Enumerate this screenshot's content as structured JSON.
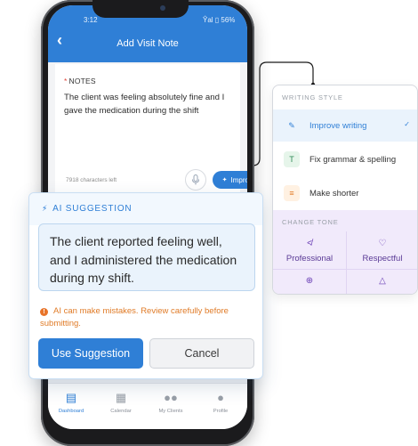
{
  "status": {
    "time": "3:12",
    "right": "Ŷal ▯ 56%"
  },
  "app": {
    "back_icon": "chevron-left-icon",
    "title": "Add Visit Note"
  },
  "notes": {
    "label_required": "*",
    "label": "NOTES",
    "text": "The client was feeling absolutely fine and I gave the medication during the shift",
    "chars_left": "7918 characters left"
  },
  "toolbar": {
    "improve_label": "Improve"
  },
  "tabbar": {
    "items": [
      {
        "label": "Dashboard",
        "icon": "dashboard-icon"
      },
      {
        "label": "Calendar",
        "icon": "calendar-icon"
      },
      {
        "label": "My Clients",
        "icon": "clients-icon"
      },
      {
        "label": "Profile",
        "icon": "profile-icon"
      }
    ]
  },
  "ai": {
    "title": "AI SUGGESTION",
    "suggestion": "The client reported feeling well, and I administered the medication during my shift.",
    "warning": "AI can make mistakes. Review carefully before submitting.",
    "use_label": "Use Suggestion",
    "cancel_label": "Cancel"
  },
  "menu": {
    "writing_style_label": "WRITING STYLE",
    "items": [
      {
        "label": "Improve writing",
        "selected": true
      },
      {
        "label": "Fix grammar & spelling",
        "selected": false
      },
      {
        "label": "Make shorter",
        "selected": false
      }
    ],
    "change_tone_label": "CHANGE TONE",
    "tones": [
      {
        "label": "Professional"
      },
      {
        "label": "Respectful"
      },
      {
        "label": ""
      },
      {
        "label": ""
      }
    ]
  },
  "colors": {
    "primary": "#2f7fd6",
    "warning": "#e07b27",
    "tone_bg": "#f1eafb",
    "tone_accent": "#6a3fb5"
  }
}
